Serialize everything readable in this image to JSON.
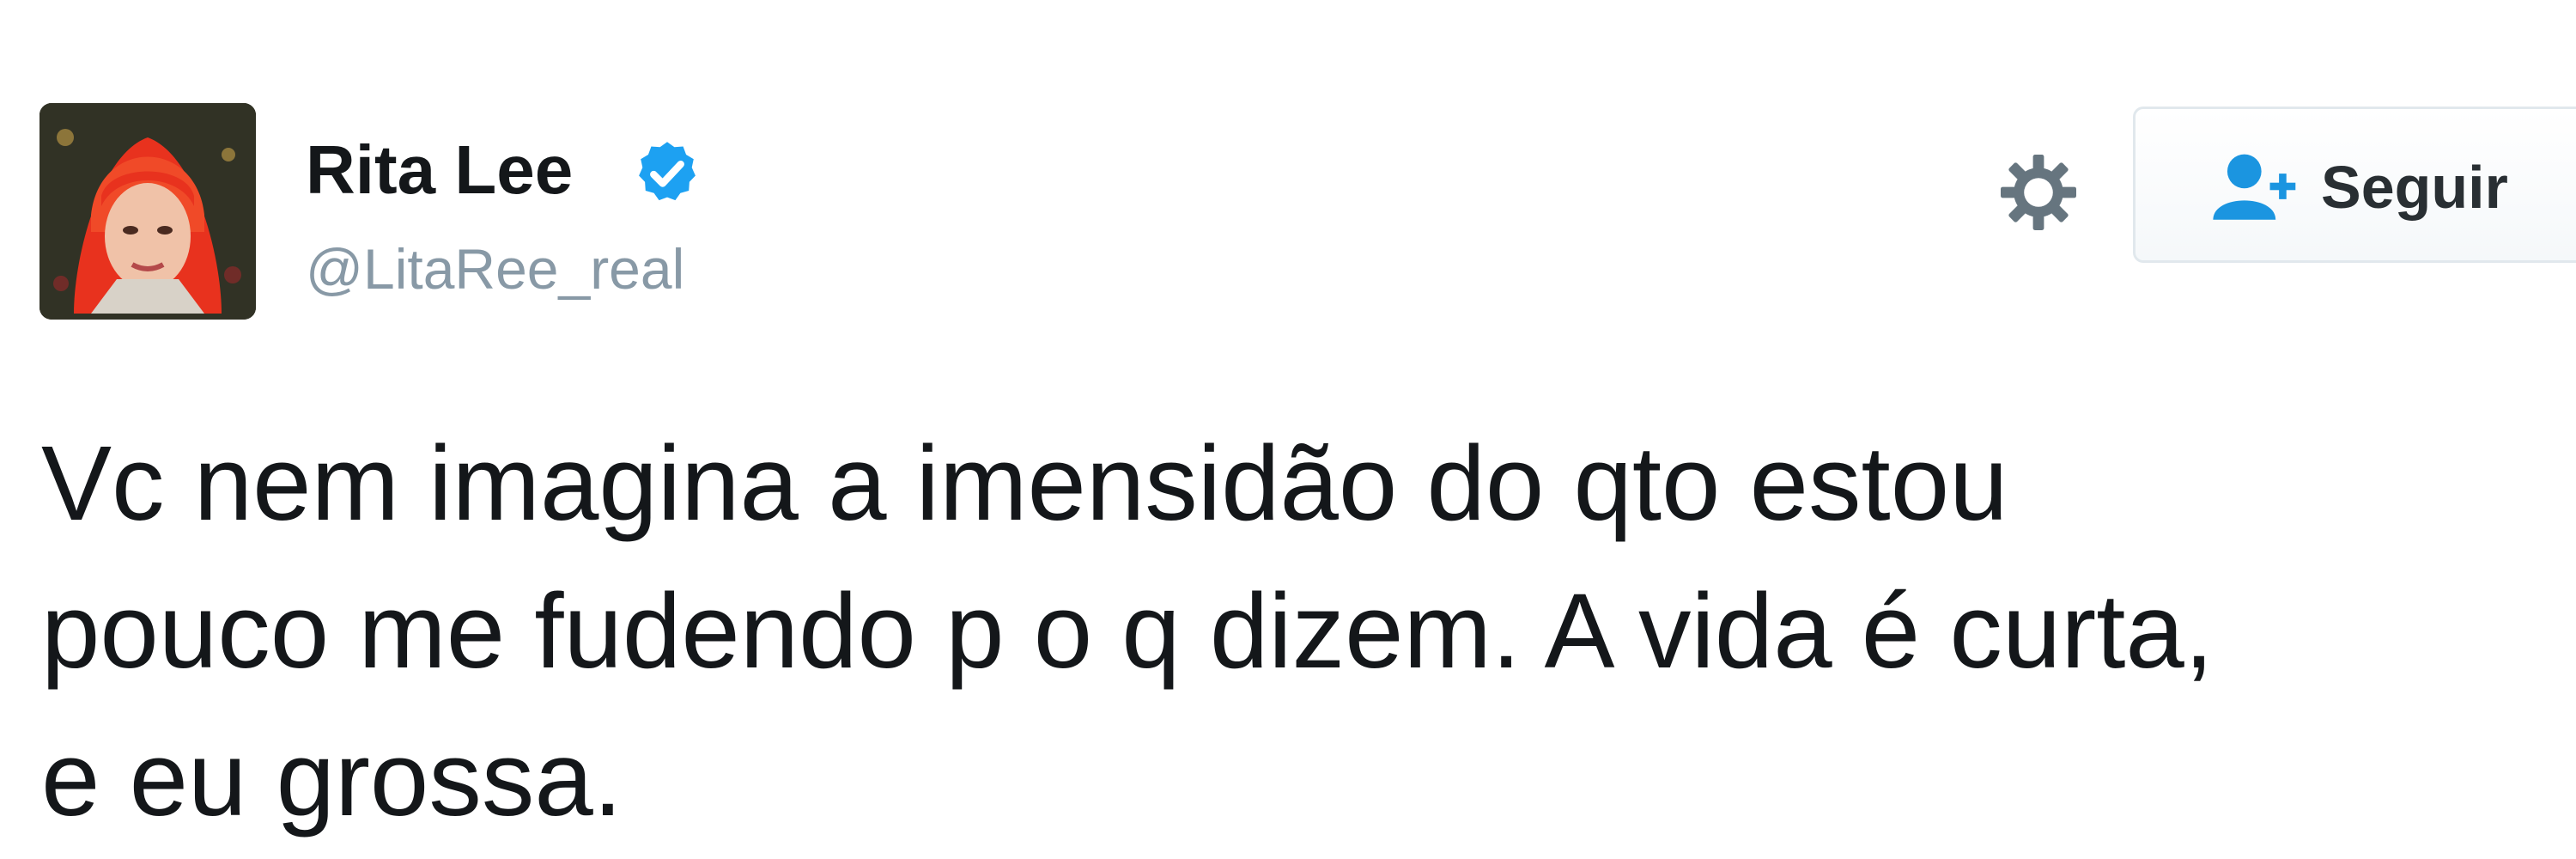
{
  "tweet": {
    "author": {
      "display_name": "Rita Lee",
      "handle": "@LitaRee_real",
      "verified": true,
      "avatar_icon": "avatar-red-hair-portrait"
    },
    "actions": {
      "settings_icon": "gear-icon",
      "follow_icon": "add-user-icon",
      "follow_label": "Seguir"
    },
    "text_lines": [
      "Vc nem imagina a imensidão do qto estou",
      "pouco me fudendo p o q dizem. A vida é curta,",
      "e eu grossa."
    ]
  },
  "colors": {
    "text": "#14171a",
    "handle": "#8899a6",
    "verified_badge": "#1da1f2",
    "follow_icon": "#1b95e0",
    "button_border": "#e1e8ed",
    "gear": "#66757f"
  }
}
